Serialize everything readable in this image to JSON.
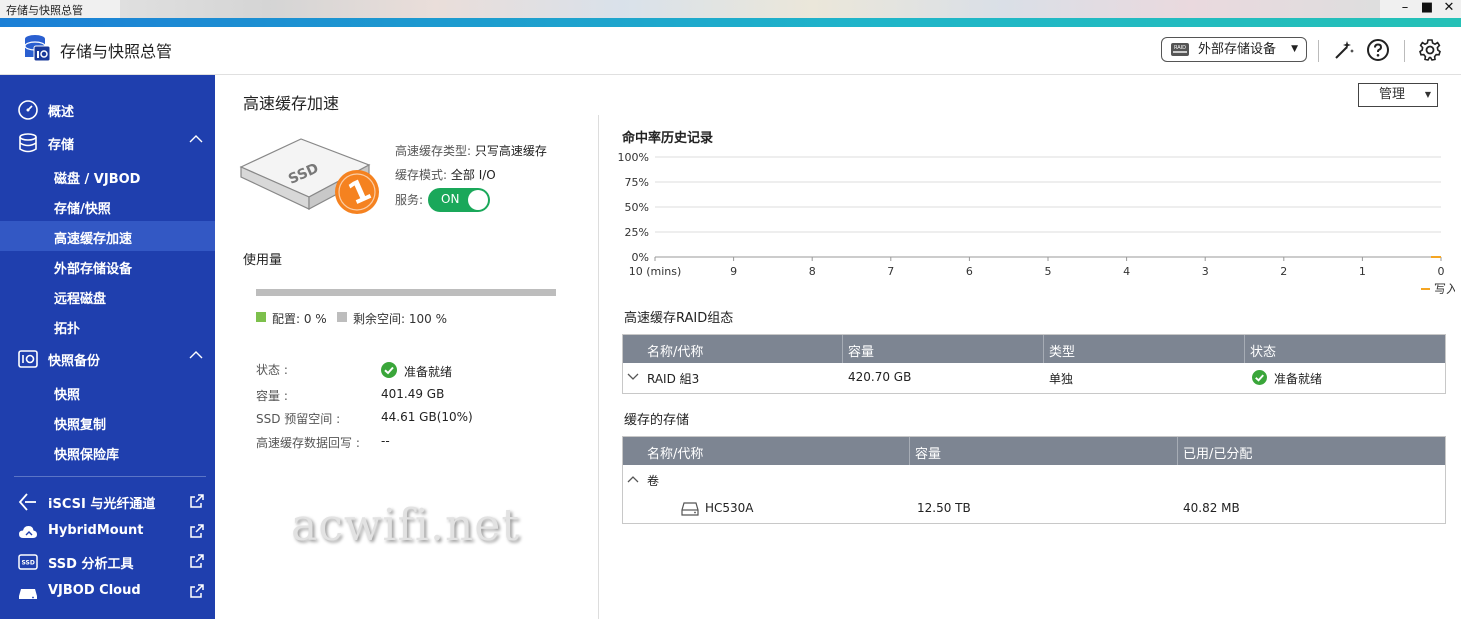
{
  "window": {
    "title": "存储与快照总管"
  },
  "header": {
    "app_title": "存储与快照总管",
    "external_storage_label": "外部存储设备"
  },
  "sidebar": {
    "items": [
      {
        "label": "概述"
      },
      {
        "label": "存储"
      },
      {
        "label": "磁盘 / VJBOD"
      },
      {
        "label": "存储/快照"
      },
      {
        "label": "高速缓存加速"
      },
      {
        "label": "外部存储设备"
      },
      {
        "label": "远程磁盘"
      },
      {
        "label": "拓扑"
      },
      {
        "label": "快照备份"
      },
      {
        "label": "快照"
      },
      {
        "label": "快照复制"
      },
      {
        "label": "快照保险库"
      },
      {
        "label": "iSCSI 与光纤通道"
      },
      {
        "label": "HybridMount"
      },
      {
        "label": "SSD 分析工具"
      },
      {
        "label": "VJBOD Cloud"
      }
    ]
  },
  "main": {
    "title": "高速缓存加速",
    "manage_label": "管理",
    "ssd_label": "SSD",
    "ssd_badge": "1",
    "cache_type_label": "高速缓存类型:",
    "cache_type_value": "只写高速缓存",
    "cache_mode_label": "缓存模式:",
    "cache_mode_value": "全部 I/O",
    "service_label": "服务:",
    "service_toggle": "ON",
    "usage_title": "使用量",
    "usage_configured_fraction": 0,
    "legend_configured": "配置: 0 %",
    "legend_free": "剩余空间: 100 %",
    "status_label": "状态 :",
    "status_value": "准备就绪",
    "capacity_label": "容量 :",
    "capacity_value": "401.49 GB",
    "ssd_reserve_label": "SSD 预留空间 :",
    "ssd_reserve_value": "44.61 GB(10%)",
    "writeback_label": "高速缓存数据回写 :",
    "writeback_value": "--",
    "watermark": "acwifi.net"
  },
  "chart": {
    "title": "命中率历史记录",
    "legend": "写入"
  },
  "chart_data": {
    "type": "line",
    "title": "命中率历史记录",
    "x_ticks": [
      "10 (mins)",
      "9",
      "8",
      "7",
      "6",
      "5",
      "4",
      "3",
      "2",
      "1",
      "0"
    ],
    "y_ticks": [
      "100%",
      "75%",
      "50%",
      "25%",
      "0%"
    ],
    "ylim": [
      0,
      100
    ],
    "grid": true,
    "legend_position": "bottom-right",
    "series": [
      {
        "name": "写入",
        "color": "#f5a623",
        "x": [
          0
        ],
        "y": [
          0
        ]
      }
    ]
  },
  "raid_section": {
    "title": "高速缓存RAID组态",
    "columns": [
      "名称/代称",
      "容量",
      "类型",
      "状态"
    ],
    "rows": [
      {
        "name": "RAID 組3",
        "capacity": "420.70 GB",
        "type": "单独",
        "status": "准备就绪"
      }
    ]
  },
  "cached_section": {
    "title": "缓存的存储",
    "columns": [
      "名称/代称",
      "容量",
      "已用/已分配"
    ],
    "group_label": "卷",
    "rows": [
      {
        "name": "HC530A",
        "capacity": "12.50 TB",
        "used": "40.82 MB"
      }
    ]
  },
  "colors": {
    "sidebar": "#1f3fae",
    "sidebar_active": "#3358c4",
    "toggle_on": "#1aa85a",
    "ok": "#3aa63a",
    "accent": "#f5a623"
  }
}
